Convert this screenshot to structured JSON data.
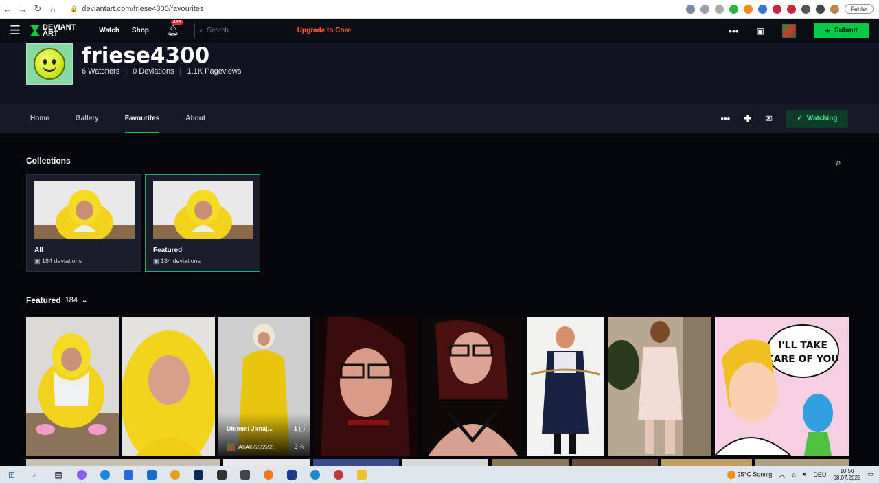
{
  "browser": {
    "url": "deviantart.com/friese4300/favourites",
    "profile_status": "Fehler"
  },
  "topbar": {
    "logo_line1": "DEVIANT",
    "logo_line2": "ART",
    "watch": "Watch",
    "shop": "Shop",
    "notif_count": "493",
    "search_placeholder": "Search",
    "upgrade": "Upgrade to Core",
    "submit": "Submit"
  },
  "profile": {
    "username": "friese4300",
    "watchers": "6 Watchers",
    "deviations": "0 Deviations",
    "pageviews": "1.1K Pageviews"
  },
  "tabs": [
    {
      "label": "Home"
    },
    {
      "label": "Gallery"
    },
    {
      "label": "Favourites"
    },
    {
      "label": "About"
    }
  ],
  "watching_label": "Watching",
  "collections": {
    "title": "Collections",
    "items": [
      {
        "name": "All",
        "count": "184 deviations"
      },
      {
        "name": "Featured",
        "count": "184 deviations"
      }
    ]
  },
  "featured": {
    "title": "Featured",
    "count": "184",
    "hover": {
      "title": "Dhimmi Jirnaj...",
      "comments": "1",
      "author": "AliAli222222...",
      "favs": "2"
    },
    "tile_image_text": "I'LL TAKE CARE OF YOU"
  },
  "taskbar": {
    "weather": "25°C Sonnig",
    "lang": "DEU",
    "time": "10:50",
    "date": "08.07.2023"
  },
  "colors": {
    "accent": "#05cc47",
    "upgrade": "#ff5a3c",
    "bg": "#06070d"
  }
}
